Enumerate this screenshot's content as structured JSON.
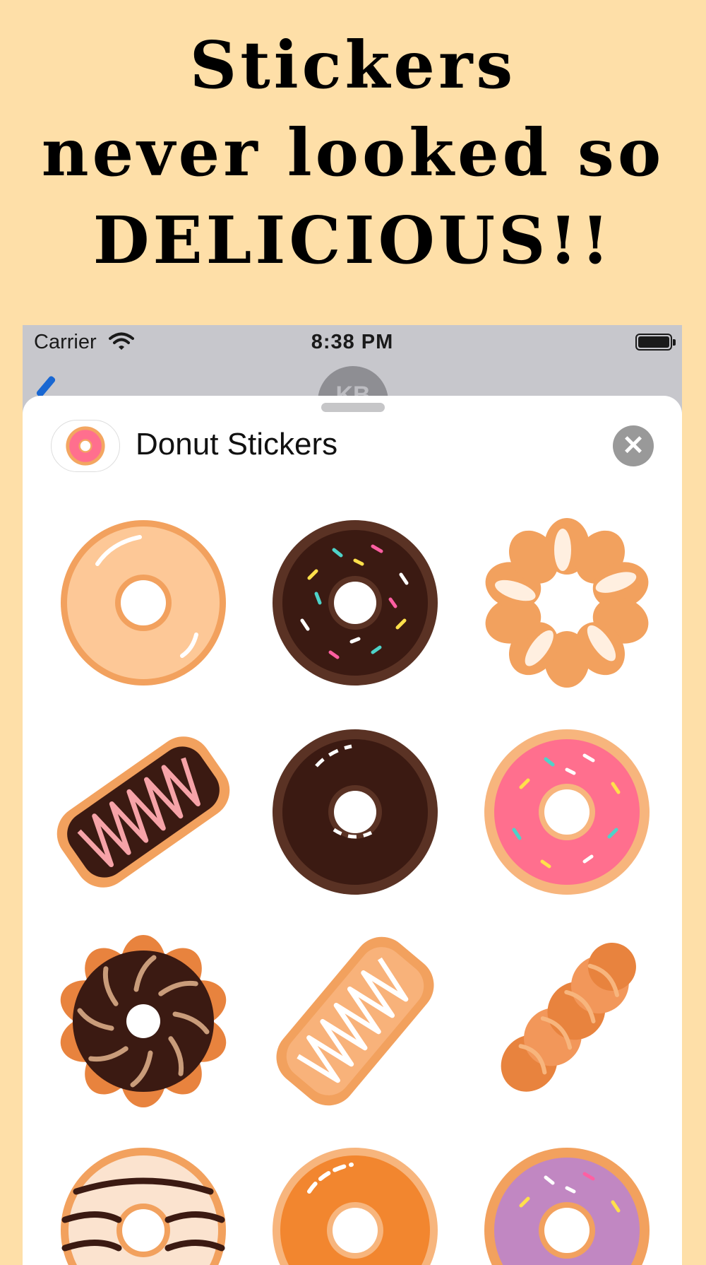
{
  "promo": {
    "line1": "Stickers",
    "line2": "never looked so",
    "line3": "DELICIOUS!!"
  },
  "status_bar": {
    "carrier": "Carrier",
    "time": "8:38 PM"
  },
  "contact": {
    "initials": "KB"
  },
  "sheet": {
    "title": "Donut Stickers",
    "close_symbol": "✕"
  },
  "stickers": [
    "glazed-donut-icon",
    "chocolate-sprinkle-donut-icon",
    "french-cruller-icon",
    "chocolate-long-john-icon",
    "chocolate-glazed-donut-icon",
    "pink-sprinkle-donut-icon",
    "chocolate-cruller-icon",
    "glazed-long-john-icon",
    "twist-donut-icon",
    "chocolate-drizzle-donut-icon",
    "orange-glazed-donut-icon",
    "purple-sprinkle-donut-icon"
  ],
  "colors": {
    "background": "#FEDFA8",
    "dough": "#F2A15E",
    "glaze": "#FDC897",
    "chocolate": "#3B1A12",
    "pink_frosting": "#FF6F8E",
    "purple_frosting": "#C187C2",
    "close_button": "#999999"
  }
}
